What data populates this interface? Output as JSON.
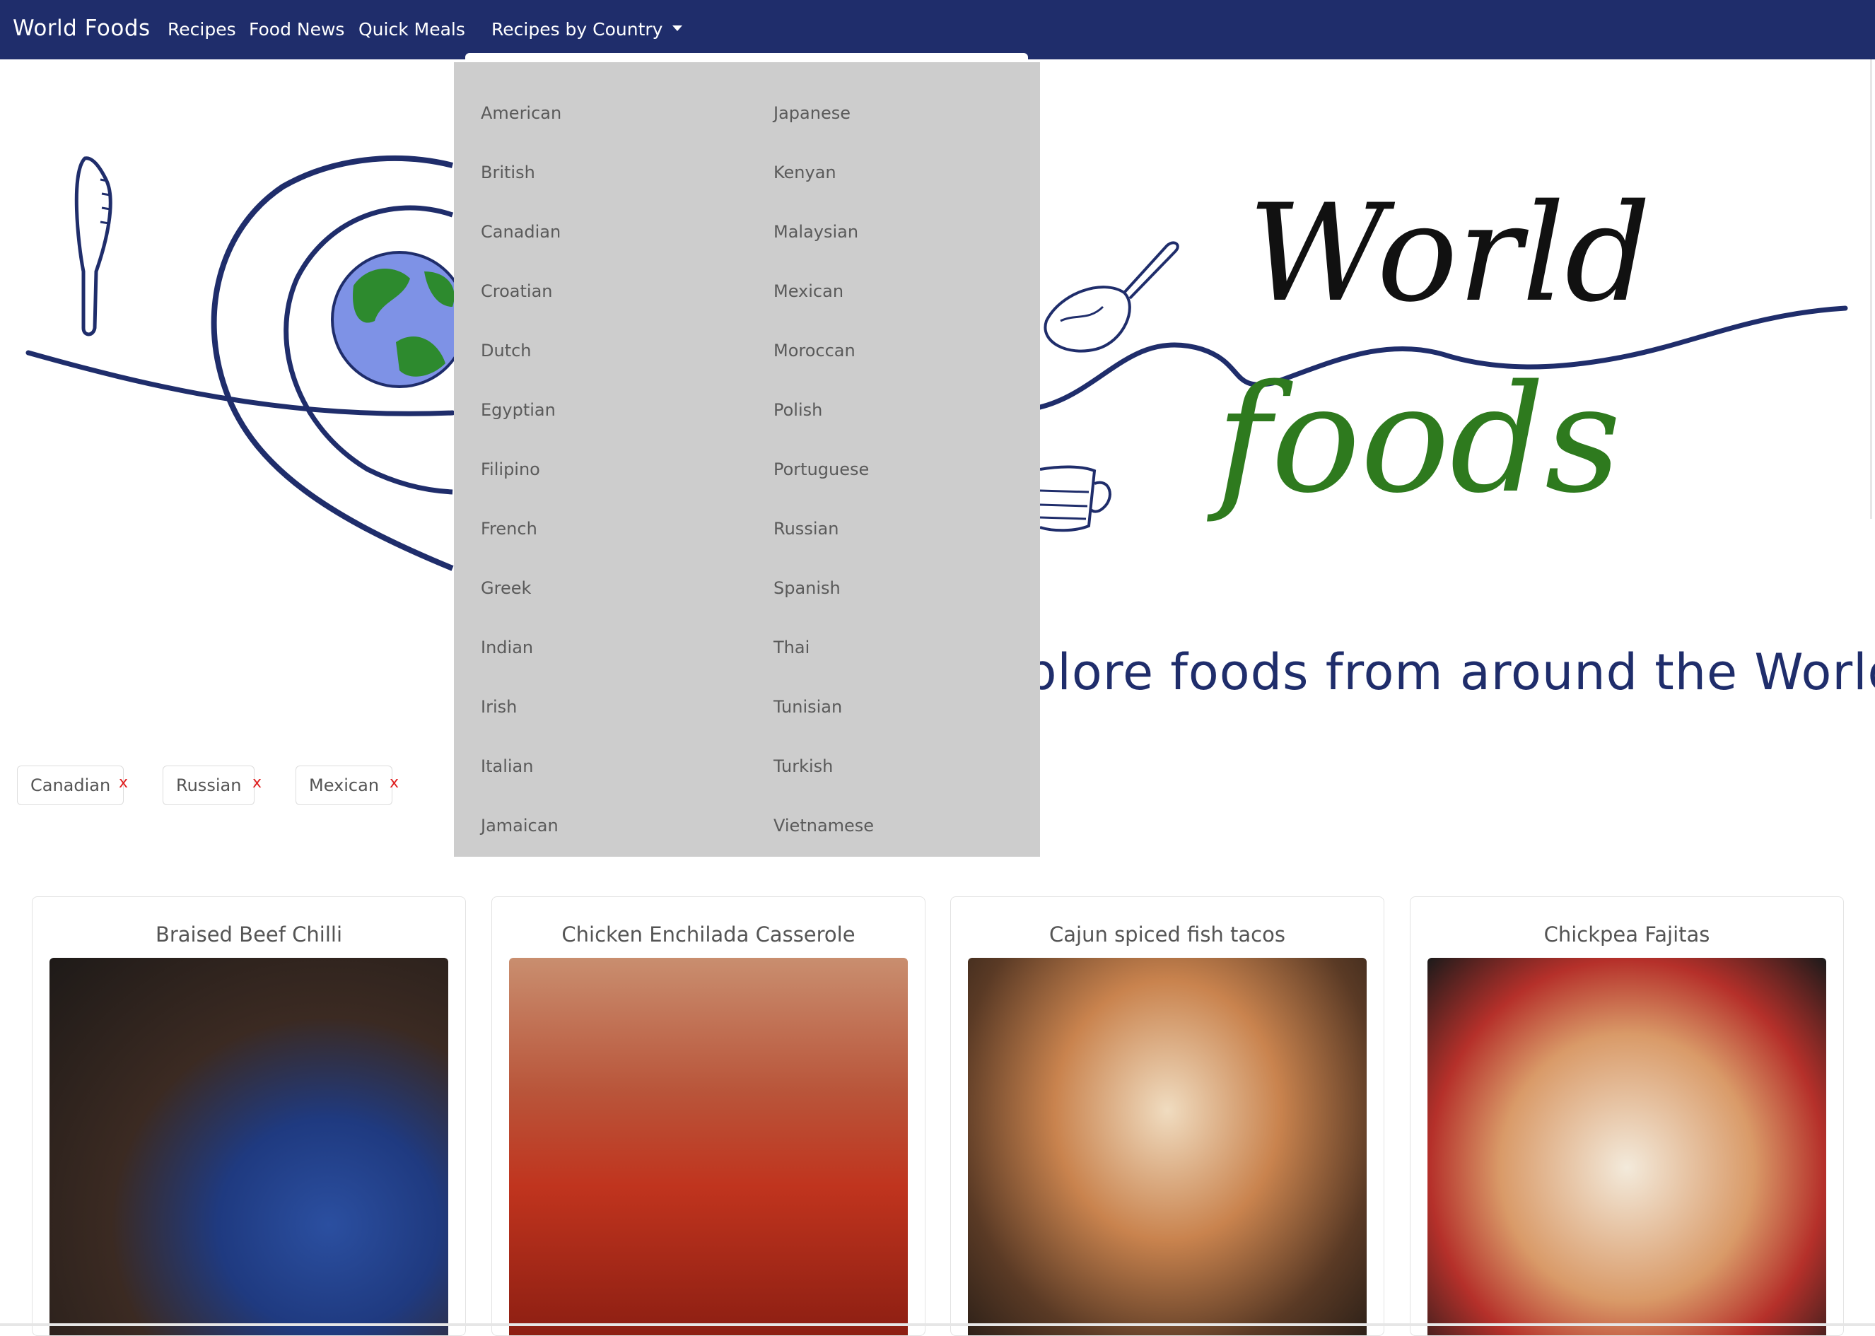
{
  "navbar": {
    "brand": "World Foods",
    "links": [
      "Recipes",
      "Food News",
      "Quick Meals"
    ],
    "dropdown_label": "Recipes by Country",
    "bg_color": "#1f2d6b"
  },
  "hero": {
    "logo_word_1": "World",
    "logo_word_2": "foods",
    "tagline": "plore foods from around the World"
  },
  "dropdown": {
    "col1": [
      "American",
      "British",
      "Canadian",
      "Croatian",
      "Dutch",
      "Egyptian",
      "Filipino",
      "French",
      "Greek",
      "Indian",
      "Irish",
      "Italian",
      "Jamaican"
    ],
    "col2": [
      "Japanese",
      "Kenyan",
      "Malaysian",
      "Mexican",
      "Moroccan",
      "Polish",
      "Portuguese",
      "Russian",
      "Spanish",
      "Thai",
      "Tunisian",
      "Turkish",
      "Vietnamese"
    ]
  },
  "filters": [
    {
      "label": "Canadian",
      "remove": "x"
    },
    {
      "label": "Russian",
      "remove": "x"
    },
    {
      "label": "Mexican",
      "remove": "x"
    }
  ],
  "cards": [
    {
      "title": "Braised Beef Chilli"
    },
    {
      "title": "Chicken Enchilada Casserole"
    },
    {
      "title": "Cajun spiced fish tacos"
    },
    {
      "title": "Chickpea Fajitas"
    }
  ],
  "colors": {
    "navy": "#1f2d6b",
    "green": "#2e7a1e",
    "remove_red": "#e02020",
    "dropdown_bg": "#cdcdcd"
  }
}
